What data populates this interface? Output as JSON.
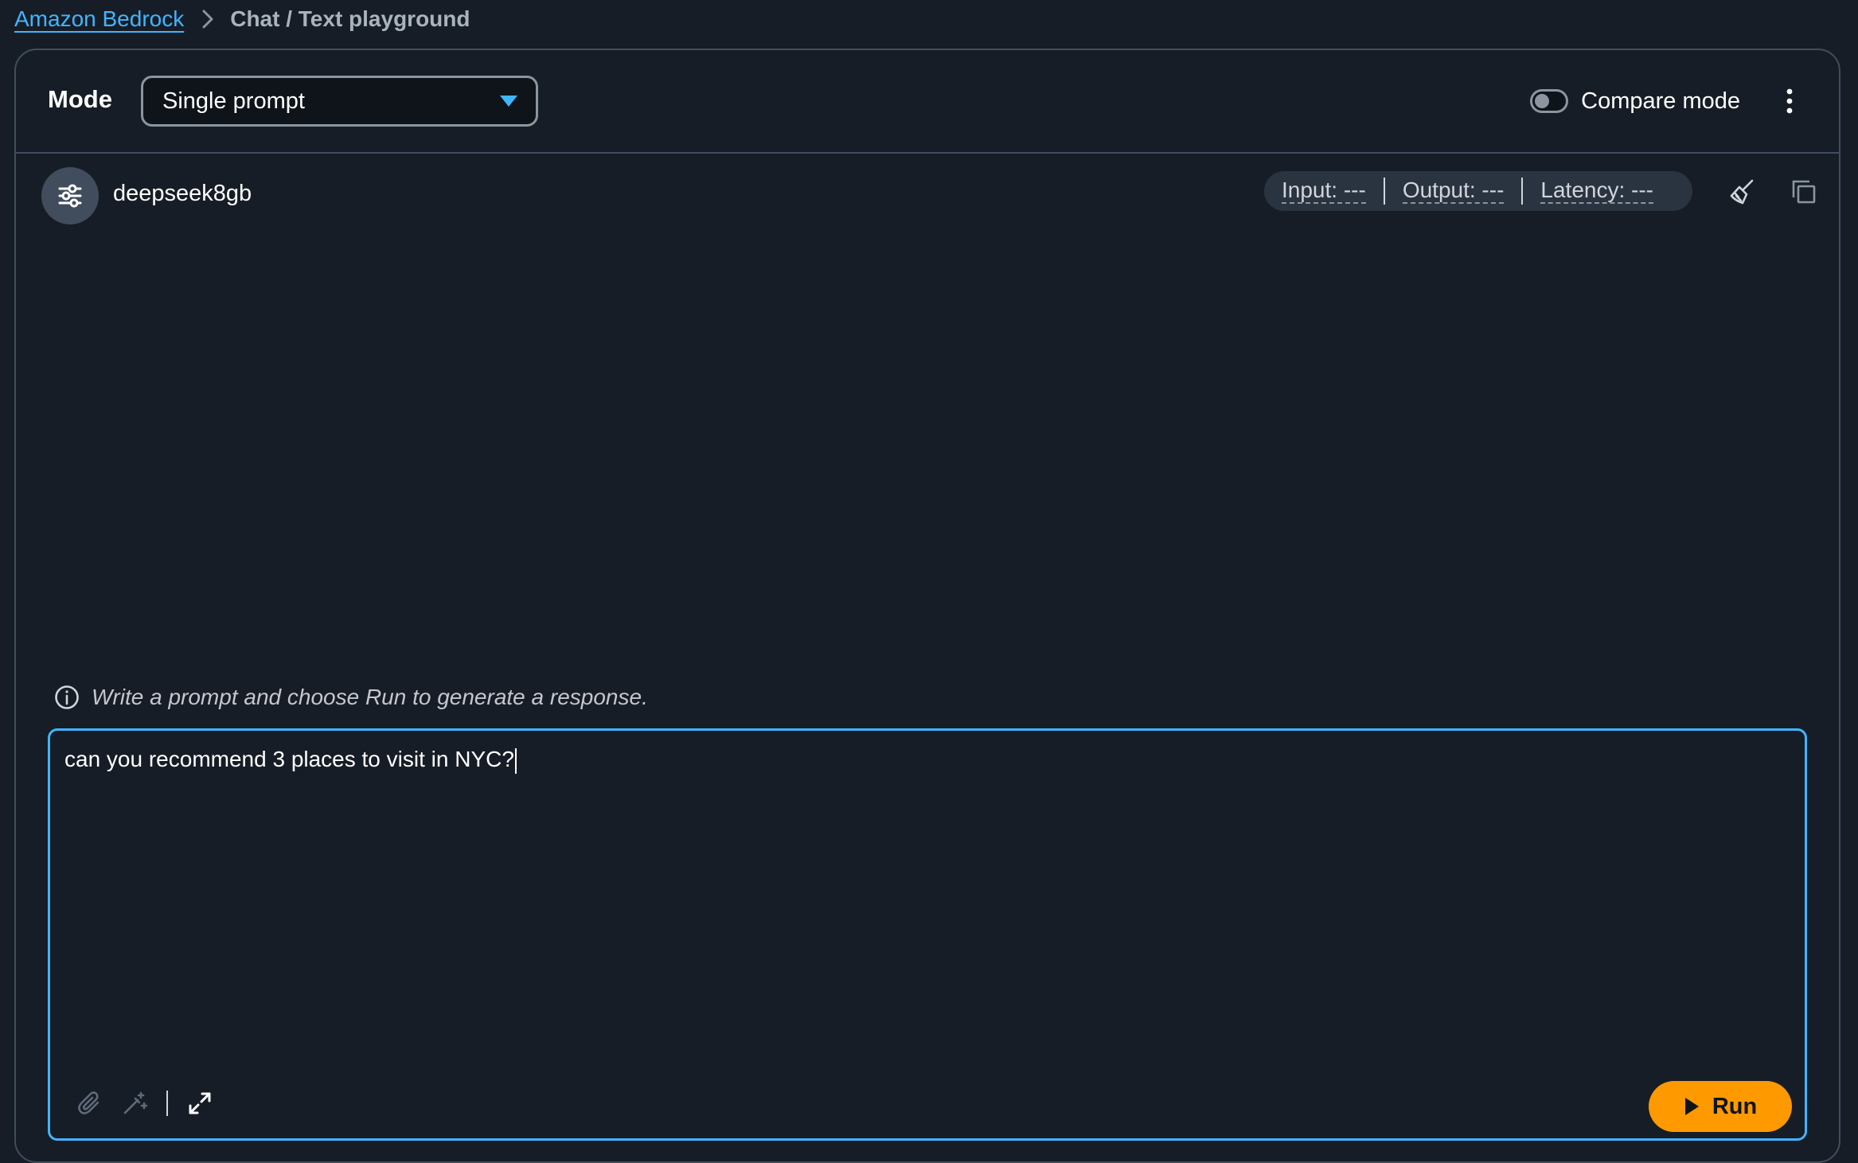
{
  "breadcrumb": {
    "root": "Amazon Bedrock",
    "current": "Chat / Text playground"
  },
  "mode": {
    "label": "Mode",
    "selected": "Single prompt",
    "compare_label": "Compare mode",
    "compare_enabled": false
  },
  "model": {
    "name": "deepseek8gb",
    "metrics": {
      "input": "Input: ---",
      "output": "Output: ---",
      "latency": "Latency: ---"
    }
  },
  "prompt": {
    "hint": "Write a prompt and choose Run to generate a response.",
    "text": "can you recommend 3 places to visit in NYC?",
    "run_label": "Run"
  },
  "icons": {
    "breadcrumb_separator": "chevron-right-icon",
    "dropdown_caret": "caret-down-icon",
    "more": "vertical-ellipsis-icon",
    "model_settings": "sliders-icon",
    "clear": "broom-icon",
    "copy": "copy-icon",
    "info": "info-circle-icon",
    "attach": "paperclip-icon",
    "magic": "magic-wand-icon",
    "expand": "expand-icon",
    "play": "play-icon"
  },
  "colors": {
    "background": "#161d26",
    "border": "#414d5c",
    "link": "#42b4ff",
    "focus": "#42b4ff",
    "accent": "#ff9900"
  }
}
